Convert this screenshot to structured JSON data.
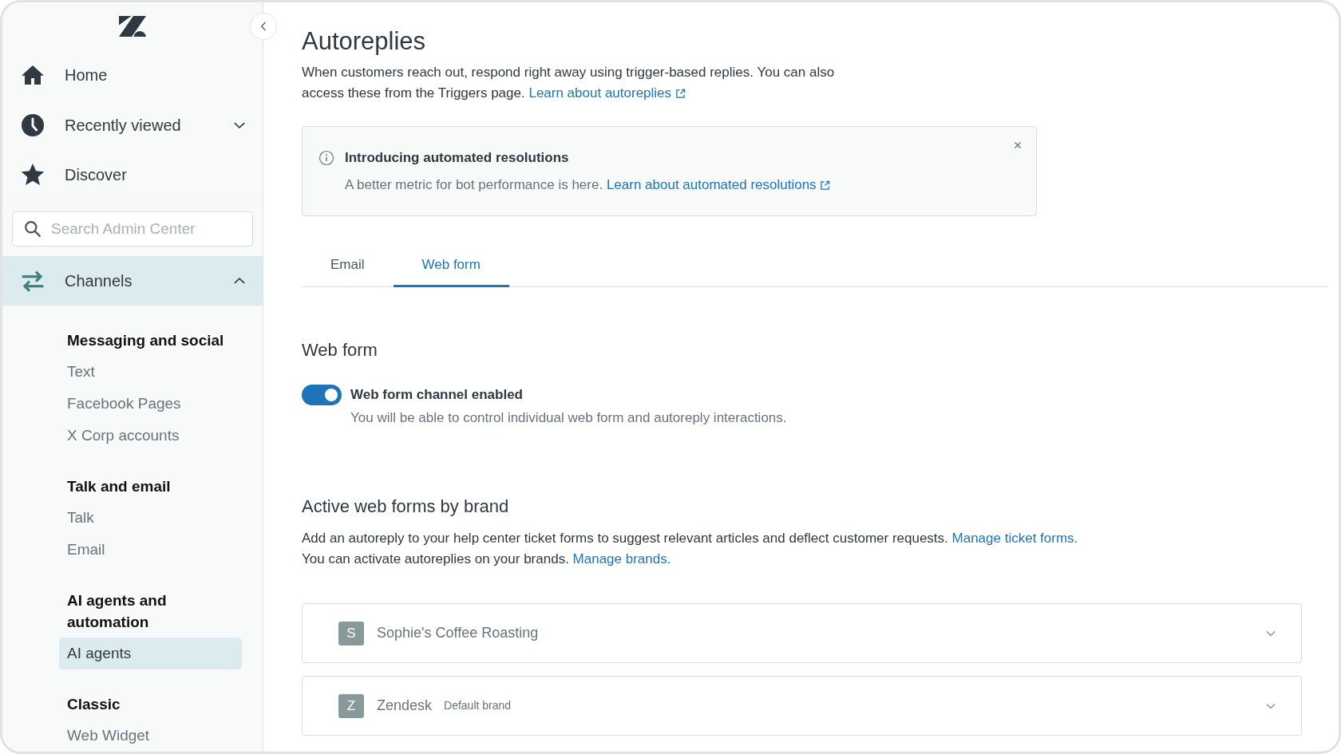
{
  "sidebar": {
    "nav": [
      {
        "kind": "home",
        "label": "Home"
      },
      {
        "kind": "clock",
        "label": "Recently viewed",
        "expanded": false
      },
      {
        "kind": "star",
        "label": "Discover"
      }
    ],
    "search": {
      "placeholder": "Search Admin Center"
    },
    "section": {
      "kind": "arrows",
      "label": "Channels",
      "expanded": true,
      "selected": true
    },
    "groups": [
      {
        "title": "Messaging and social",
        "items": [
          {
            "label": "Text",
            "selected": false
          },
          {
            "label": "Facebook Pages",
            "selected": false
          },
          {
            "label": "X Corp accounts",
            "selected": false
          }
        ]
      },
      {
        "title": "Talk and email",
        "items": [
          {
            "label": "Talk",
            "selected": false
          },
          {
            "label": "Email",
            "selected": false
          }
        ]
      },
      {
        "title": "AI agents and automation",
        "items": [
          {
            "label": "AI agents",
            "selected": true
          }
        ]
      },
      {
        "title": "Classic",
        "items": [
          {
            "label": "Web Widget",
            "selected": false
          }
        ]
      }
    ]
  },
  "page": {
    "title": "Autoreplies",
    "description": {
      "text": "When customers reach out, respond right away using trigger-based replies. You can also access these from the Triggers page.",
      "link": "Learn about autoreplies"
    },
    "notice": {
      "title": "Introducing automated resolutions",
      "text": "A better metric for bot performance is here.",
      "link": "Learn about automated resolutions"
    },
    "tabs": [
      {
        "label": "Email",
        "selected": false
      },
      {
        "label": "Web form",
        "selected": true
      }
    ],
    "web_form": {
      "heading": "Web form",
      "toggle": {
        "label": "Web form channel enabled",
        "description": "You will be able to control individual web form and autoreply interactions.",
        "on": true
      }
    },
    "brands_section": {
      "heading": "Active web forms by brand",
      "lines": [
        {
          "text": "Add an autoreply to your help center ticket forms to suggest relevant articles and deflect customer requests.",
          "link": "Manage ticket forms."
        },
        {
          "text": "You can activate autoreplies on your brands.",
          "link": "Manage brands."
        }
      ]
    },
    "brands": [
      {
        "initial": "S",
        "name": "Sophie's Coffee Roasting",
        "expanded": false
      },
      {
        "initial": "Z",
        "name": "Zendesk",
        "tag": "Default brand",
        "expanded": false
      }
    ]
  }
}
